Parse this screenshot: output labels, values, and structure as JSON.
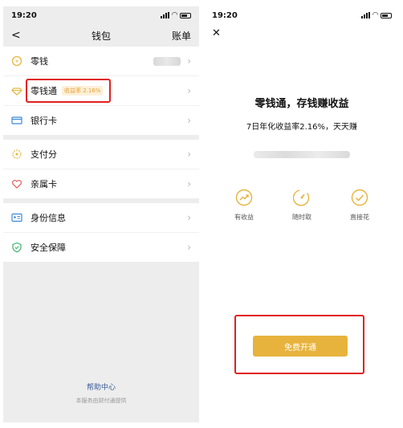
{
  "left": {
    "status": {
      "time": "19:20"
    },
    "nav": {
      "back": "<",
      "title": "钱包",
      "action": "账单"
    },
    "groups": [
      [
        {
          "label": "零钱",
          "icon": "coin-icon"
        },
        {
          "label": "零钱通",
          "tag": "收益率 2.16%",
          "icon": "diamond-icon"
        },
        {
          "label": "银行卡",
          "icon": "card-icon"
        }
      ],
      [
        {
          "label": "支付分",
          "icon": "score-icon"
        },
        {
          "label": "亲属卡",
          "icon": "heart-icon"
        }
      ],
      [
        {
          "label": "身份信息",
          "icon": "id-icon"
        },
        {
          "label": "安全保障",
          "icon": "shield-icon"
        }
      ]
    ],
    "footer": {
      "help": "帮助中心",
      "sub": "本服务由财付通提供"
    }
  },
  "right": {
    "status": {
      "time": "19:20"
    },
    "close": "✕",
    "headline": "零钱通，存钱赚收益",
    "subline": "7日年化收益率2.16%，天天赚",
    "features": [
      {
        "label": "有收益",
        "icon": "trend-icon"
      },
      {
        "label": "随时取",
        "icon": "clock-icon"
      },
      {
        "label": "直接花",
        "icon": "check-icon"
      }
    ],
    "button": "免费开通"
  },
  "colors": {
    "accent": "#e7b33d",
    "highlight": "#e02020",
    "link": "#3a5c99"
  }
}
